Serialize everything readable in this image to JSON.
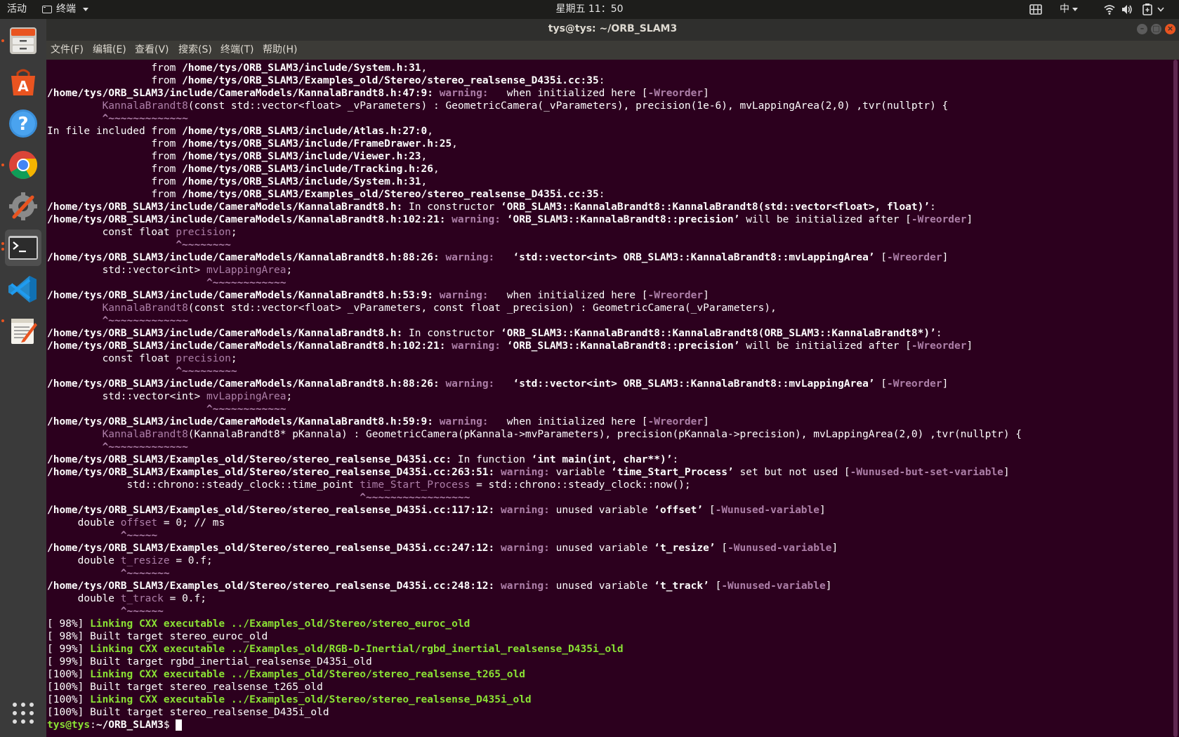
{
  "topbar": {
    "activities": "活动",
    "app_menu_label": "终端",
    "clock": "星期五 11：50",
    "input_method": "中"
  },
  "dock": {
    "items": [
      {
        "name": "files",
        "icon": "file-cabinet-icon",
        "running": true
      },
      {
        "name": "software",
        "icon": "software-center-icon",
        "running": false
      },
      {
        "name": "help",
        "icon": "help-icon",
        "running": false
      },
      {
        "name": "chrome",
        "icon": "chrome-icon",
        "running": true
      },
      {
        "name": "settings",
        "icon": "settings-tools-icon",
        "running": false
      },
      {
        "name": "terminal",
        "icon": "terminal-icon",
        "running": true,
        "active": true
      },
      {
        "name": "vscode",
        "icon": "vscode-icon",
        "running": false
      },
      {
        "name": "text-editor",
        "icon": "text-editor-icon",
        "running": true
      }
    ],
    "apps_grid_icon": "apps-grid-icon"
  },
  "window": {
    "title": "tys@tys: ~/ORB_SLAM3"
  },
  "menubar": [
    "文件(F)",
    "编辑(E)",
    "查看(V)",
    "搜索(S)",
    "终端(T)",
    "帮助(H)"
  ],
  "colors": {
    "terminal_bg": "#2c001e",
    "warning_magenta": "#ad7fa8",
    "green": "#8ae234",
    "text": "#ffffff",
    "accent_orange": "#e95420"
  },
  "terminal_lines": [
    [
      [
        "n",
        "                 from "
      ],
      [
        "b",
        "/home/tys/ORB_SLAM3/include/System.h:31"
      ],
      [
        "n",
        ","
      ]
    ],
    [
      [
        "n",
        "                 from "
      ],
      [
        "b",
        "/home/tys/ORB_SLAM3/Examples_old/Stereo/stereo_realsense_D435i.cc:35"
      ],
      [
        "n",
        ":"
      ]
    ],
    [
      [
        "b",
        "/home/tys/ORB_SLAM3/include/CameraModels/KannalaBrandt8.h:47:9: "
      ],
      [
        "w",
        "warning: "
      ],
      [
        "n",
        "  when initialized here ["
      ],
      [
        "w",
        "-Wreorder"
      ],
      [
        "n",
        "]"
      ]
    ],
    [
      [
        "n",
        "         "
      ],
      [
        "m",
        "KannalaBrandt8"
      ],
      [
        "n",
        "(const std::vector<float> _vParameters) : GeometricCamera(_vParameters), precision(1e-6), mvLappingArea(2,0) ,tvr(nullptr) {"
      ]
    ],
    [
      [
        "n",
        "         "
      ],
      [
        "w",
        "^~~~~~~~~~~~~~"
      ]
    ],
    [
      [
        "n",
        "In file included from "
      ],
      [
        "b",
        "/home/tys/ORB_SLAM3/include/Atlas.h:27:0"
      ],
      [
        "n",
        ","
      ]
    ],
    [
      [
        "n",
        "                 from "
      ],
      [
        "b",
        "/home/tys/ORB_SLAM3/include/FrameDrawer.h:25"
      ],
      [
        "n",
        ","
      ]
    ],
    [
      [
        "n",
        "                 from "
      ],
      [
        "b",
        "/home/tys/ORB_SLAM3/include/Viewer.h:23"
      ],
      [
        "n",
        ","
      ]
    ],
    [
      [
        "n",
        "                 from "
      ],
      [
        "b",
        "/home/tys/ORB_SLAM3/include/Tracking.h:26"
      ],
      [
        "n",
        ","
      ]
    ],
    [
      [
        "n",
        "                 from "
      ],
      [
        "b",
        "/home/tys/ORB_SLAM3/include/System.h:31"
      ],
      [
        "n",
        ","
      ]
    ],
    [
      [
        "n",
        "                 from "
      ],
      [
        "b",
        "/home/tys/ORB_SLAM3/Examples_old/Stereo/stereo_realsense_D435i.cc:35"
      ],
      [
        "n",
        ":"
      ]
    ],
    [
      [
        "b",
        "/home/tys/ORB_SLAM3/include/CameraModels/KannalaBrandt8.h:"
      ],
      [
        "n",
        " In constructor "
      ],
      [
        "b",
        "‘ORB_SLAM3::KannalaBrandt8::KannalaBrandt8(std::vector<float>, float)’"
      ],
      [
        "n",
        ":"
      ]
    ],
    [
      [
        "b",
        "/home/tys/ORB_SLAM3/include/CameraModels/KannalaBrandt8.h:102:21: "
      ],
      [
        "w",
        "warning: "
      ],
      [
        "b",
        "‘ORB_SLAM3::KannalaBrandt8::precision’"
      ],
      [
        "n",
        " will be initialized after ["
      ],
      [
        "w",
        "-Wreorder"
      ],
      [
        "n",
        "]"
      ]
    ],
    [
      [
        "n",
        "         const float "
      ],
      [
        "m",
        "precision"
      ],
      [
        "n",
        ";"
      ]
    ],
    [
      [
        "n",
        "                     "
      ],
      [
        "w",
        "^~~~~~~~~"
      ]
    ],
    [
      [
        "b",
        "/home/tys/ORB_SLAM3/include/CameraModels/KannalaBrandt8.h:88:26: "
      ],
      [
        "w",
        "warning: "
      ],
      [
        "n",
        "  "
      ],
      [
        "b",
        "‘std::vector<int> ORB_SLAM3::KannalaBrandt8::mvLappingArea’"
      ],
      [
        "n",
        " ["
      ],
      [
        "w",
        "-Wreorder"
      ],
      [
        "n",
        "]"
      ]
    ],
    [
      [
        "n",
        "         std::vector<int> "
      ],
      [
        "m",
        "mvLappingArea"
      ],
      [
        "n",
        ";"
      ]
    ],
    [
      [
        "n",
        "                          "
      ],
      [
        "w",
        "^~~~~~~~~~~~~"
      ]
    ],
    [
      [
        "b",
        "/home/tys/ORB_SLAM3/include/CameraModels/KannalaBrandt8.h:53:9: "
      ],
      [
        "w",
        "warning: "
      ],
      [
        "n",
        "  when initialized here ["
      ],
      [
        "w",
        "-Wreorder"
      ],
      [
        "n",
        "]"
      ]
    ],
    [
      [
        "n",
        "         "
      ],
      [
        "m",
        "KannalaBrandt8"
      ],
      [
        "n",
        "(const std::vector<float> _vParameters, const float _precision) : GeometricCamera(_vParameters),"
      ]
    ],
    [
      [
        "n",
        "         "
      ],
      [
        "w",
        "^~~~~~~~~~~~~~"
      ]
    ],
    [
      [
        "b",
        "/home/tys/ORB_SLAM3/include/CameraModels/KannalaBrandt8.h:"
      ],
      [
        "n",
        " In constructor "
      ],
      [
        "b",
        "‘ORB_SLAM3::KannalaBrandt8::KannalaBrandt8(ORB_SLAM3::KannalaBrandt8*)’"
      ],
      [
        "n",
        ":"
      ]
    ],
    [
      [
        "b",
        "/home/tys/ORB_SLAM3/include/CameraModels/KannalaBrandt8.h:102:21: "
      ],
      [
        "w",
        "warning: "
      ],
      [
        "b",
        "‘ORB_SLAM3::KannalaBrandt8::precision’"
      ],
      [
        "n",
        " will be initialized after ["
      ],
      [
        "w",
        "-Wreorder"
      ],
      [
        "n",
        "]"
      ]
    ],
    [
      [
        "n",
        "         const float "
      ],
      [
        "m",
        "precision"
      ],
      [
        "n",
        ";"
      ]
    ],
    [
      [
        "n",
        "                     "
      ],
      [
        "w",
        "^~~~~~~~~~"
      ]
    ],
    [
      [
        "b",
        "/home/tys/ORB_SLAM3/include/CameraModels/KannalaBrandt8.h:88:26: "
      ],
      [
        "w",
        "warning: "
      ],
      [
        "n",
        "  "
      ],
      [
        "b",
        "‘std::vector<int> ORB_SLAM3::KannalaBrandt8::mvLappingArea’"
      ],
      [
        "n",
        " ["
      ],
      [
        "w",
        "-Wreorder"
      ],
      [
        "n",
        "]"
      ]
    ],
    [
      [
        "n",
        "         std::vector<int> "
      ],
      [
        "m",
        "mvLappingArea"
      ],
      [
        "n",
        ";"
      ]
    ],
    [
      [
        "n",
        "                          "
      ],
      [
        "w",
        "^~~~~~~~~~~~~"
      ]
    ],
    [
      [
        "b",
        "/home/tys/ORB_SLAM3/include/CameraModels/KannalaBrandt8.h:59:9: "
      ],
      [
        "w",
        "warning: "
      ],
      [
        "n",
        "  when initialized here ["
      ],
      [
        "w",
        "-Wreorder"
      ],
      [
        "n",
        "]"
      ]
    ],
    [
      [
        "n",
        "         "
      ],
      [
        "m",
        "KannalaBrandt8"
      ],
      [
        "n",
        "(KannalaBrandt8* pKannala) : GeometricCamera(pKannala->mvParameters), precision(pKannala->precision), mvLappingArea(2,0) ,tvr(nullptr) {"
      ]
    ],
    [
      [
        "n",
        "         "
      ],
      [
        "w",
        "^~~~~~~~~~~~~~"
      ]
    ],
    [
      [
        "b",
        "/home/tys/ORB_SLAM3/Examples_old/Stereo/stereo_realsense_D435i.cc:"
      ],
      [
        "n",
        " In function "
      ],
      [
        "b",
        "‘int main(int, char**)’"
      ],
      [
        "n",
        ":"
      ]
    ],
    [
      [
        "b",
        "/home/tys/ORB_SLAM3/Examples_old/Stereo/stereo_realsense_D435i.cc:263:51: "
      ],
      [
        "w",
        "warning: "
      ],
      [
        "n",
        "variable "
      ],
      [
        "b",
        "‘time_Start_Process’"
      ],
      [
        "n",
        " set but not used ["
      ],
      [
        "w",
        "-Wunused-but-set-variable"
      ],
      [
        "n",
        "]"
      ]
    ],
    [
      [
        "n",
        "             std::chrono::steady_clock::time_point "
      ],
      [
        "m",
        "time_Start_Process"
      ],
      [
        "n",
        " = std::chrono::steady_clock::now();"
      ]
    ],
    [
      [
        "n",
        "                                                   "
      ],
      [
        "w",
        "^~~~~~~~~~~~~~~~~~"
      ]
    ],
    [
      [
        "b",
        "/home/tys/ORB_SLAM3/Examples_old/Stereo/stereo_realsense_D435i.cc:117:12: "
      ],
      [
        "w",
        "warning: "
      ],
      [
        "n",
        "unused variable "
      ],
      [
        "b",
        "‘offset’"
      ],
      [
        "n",
        " ["
      ],
      [
        "w",
        "-Wunused-variable"
      ],
      [
        "n",
        "]"
      ]
    ],
    [
      [
        "n",
        "     double "
      ],
      [
        "m",
        "offset"
      ],
      [
        "n",
        " = 0; // ms"
      ]
    ],
    [
      [
        "n",
        "            "
      ],
      [
        "w",
        "^~~~~~"
      ]
    ],
    [
      [
        "b",
        "/home/tys/ORB_SLAM3/Examples_old/Stereo/stereo_realsense_D435i.cc:247:12: "
      ],
      [
        "w",
        "warning: "
      ],
      [
        "n",
        "unused variable "
      ],
      [
        "b",
        "‘t_resize’"
      ],
      [
        "n",
        " ["
      ],
      [
        "w",
        "-Wunused-variable"
      ],
      [
        "n",
        "]"
      ]
    ],
    [
      [
        "n",
        "     double "
      ],
      [
        "m",
        "t_resize"
      ],
      [
        "n",
        " = 0.f;"
      ]
    ],
    [
      [
        "n",
        "            "
      ],
      [
        "w",
        "^~~~~~~~"
      ]
    ],
    [
      [
        "b",
        "/home/tys/ORB_SLAM3/Examples_old/Stereo/stereo_realsense_D435i.cc:248:12: "
      ],
      [
        "w",
        "warning: "
      ],
      [
        "n",
        "unused variable "
      ],
      [
        "b",
        "‘t_track’"
      ],
      [
        "n",
        " ["
      ],
      [
        "w",
        "-Wunused-variable"
      ],
      [
        "n",
        "]"
      ]
    ],
    [
      [
        "n",
        "     double "
      ],
      [
        "m",
        "t_track"
      ],
      [
        "n",
        " = 0.f;"
      ]
    ],
    [
      [
        "n",
        "            "
      ],
      [
        "w",
        "^~~~~~~"
      ]
    ],
    [
      [
        "n",
        "[ 98%] "
      ],
      [
        "g",
        "Linking CXX executable ../Examples_old/Stereo/stereo_euroc_old"
      ]
    ],
    [
      [
        "n",
        "[ 98%] Built target stereo_euroc_old"
      ]
    ],
    [
      [
        "n",
        "[ 99%] "
      ],
      [
        "g",
        "Linking CXX executable ../Examples_old/RGB-D-Inertial/rgbd_inertial_realsense_D435i_old"
      ]
    ],
    [
      [
        "n",
        "[ 99%] Built target rgbd_inertial_realsense_D435i_old"
      ]
    ],
    [
      [
        "n",
        "[100%] "
      ],
      [
        "g",
        "Linking CXX executable ../Examples_old/Stereo/stereo_realsense_t265_old"
      ]
    ],
    [
      [
        "n",
        "[100%] Built target stereo_realsense_t265_old"
      ]
    ],
    [
      [
        "n",
        "[100%] "
      ],
      [
        "g",
        "Linking CXX executable ../Examples_old/Stereo/stereo_realsense_D435i_old"
      ]
    ],
    [
      [
        "n",
        "[100%] Built target stereo_realsense_D435i_old"
      ]
    ],
    [
      [
        "g",
        "tys@tys"
      ],
      [
        "n",
        ":"
      ],
      [
        "b",
        "~/ORB_SLAM3"
      ],
      [
        "n",
        "$ "
      ],
      [
        "c",
        " "
      ]
    ]
  ]
}
